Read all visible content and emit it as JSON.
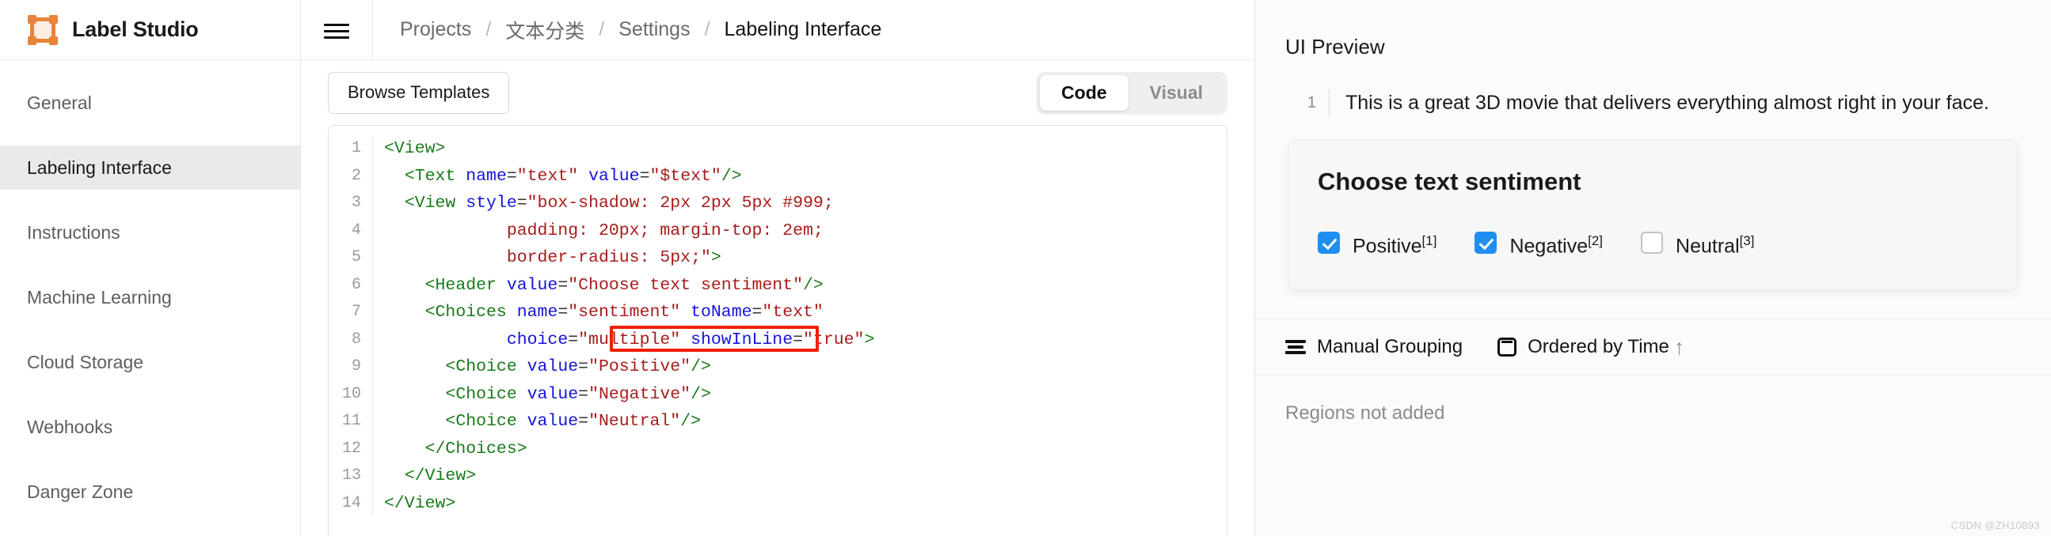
{
  "brand": {
    "title": "Label Studio",
    "logo_icon": "label-studio-logo-icon",
    "accent": "#e8833a"
  },
  "sidebar": {
    "items": [
      {
        "label": "General",
        "active": false
      },
      {
        "label": "Labeling Interface",
        "active": true
      },
      {
        "label": "Instructions",
        "active": false
      },
      {
        "label": "Machine Learning",
        "active": false
      },
      {
        "label": "Cloud Storage",
        "active": false
      },
      {
        "label": "Webhooks",
        "active": false
      },
      {
        "label": "Danger Zone",
        "active": false
      }
    ]
  },
  "topbar": {
    "menu_icon": "hamburger-menu-icon",
    "breadcrumb": [
      {
        "label": "Projects",
        "current": false
      },
      {
        "label": "文本分类",
        "current": false
      },
      {
        "label": "Settings",
        "current": false
      },
      {
        "label": "Labeling Interface",
        "current": true
      }
    ],
    "separator": "/"
  },
  "editor": {
    "browse_templates_label": "Browse Templates",
    "view_toggle": {
      "options": [
        {
          "label": "Code",
          "selected": true
        },
        {
          "label": "Visual",
          "selected": false
        }
      ]
    },
    "lines": [
      {
        "n": "1",
        "tokens": [
          {
            "t": "tg",
            "s": "<View>"
          }
        ]
      },
      {
        "n": "2",
        "tokens": [
          {
            "t": "pl",
            "s": "  "
          },
          {
            "t": "tg",
            "s": "<Text "
          },
          {
            "t": "at",
            "s": "name"
          },
          {
            "t": "pl",
            "s": "="
          },
          {
            "t": "vl",
            "s": "\"text\""
          },
          {
            "t": "pl",
            "s": " "
          },
          {
            "t": "at",
            "s": "value"
          },
          {
            "t": "pl",
            "s": "="
          },
          {
            "t": "vl",
            "s": "\"$text\""
          },
          {
            "t": "tg",
            "s": "/>"
          }
        ]
      },
      {
        "n": "3",
        "tokens": [
          {
            "t": "pl",
            "s": "  "
          },
          {
            "t": "tg",
            "s": "<View "
          },
          {
            "t": "at",
            "s": "style"
          },
          {
            "t": "pl",
            "s": "="
          },
          {
            "t": "vl",
            "s": "\"box-shadow: 2px 2px 5px #999;"
          }
        ]
      },
      {
        "n": "4",
        "tokens": [
          {
            "t": "pl",
            "s": "            "
          },
          {
            "t": "vl",
            "s": "padding: 20px; margin-top: 2em;"
          }
        ]
      },
      {
        "n": "5",
        "tokens": [
          {
            "t": "pl",
            "s": "            "
          },
          {
            "t": "vl",
            "s": "border-radius: 5px;\""
          },
          {
            "t": "tg",
            "s": ">"
          }
        ]
      },
      {
        "n": "6",
        "tokens": [
          {
            "t": "pl",
            "s": "    "
          },
          {
            "t": "tg",
            "s": "<Header "
          },
          {
            "t": "at",
            "s": "value"
          },
          {
            "t": "pl",
            "s": "="
          },
          {
            "t": "vl",
            "s": "\"Choose text sentiment\""
          },
          {
            "t": "tg",
            "s": "/>"
          }
        ]
      },
      {
        "n": "7",
        "tokens": [
          {
            "t": "pl",
            "s": "    "
          },
          {
            "t": "tg",
            "s": "<Choices "
          },
          {
            "t": "at",
            "s": "name"
          },
          {
            "t": "pl",
            "s": "="
          },
          {
            "t": "vl",
            "s": "\"sentiment\""
          },
          {
            "t": "pl",
            "s": " "
          },
          {
            "t": "at",
            "s": "toName"
          },
          {
            "t": "pl",
            "s": "="
          },
          {
            "t": "vl",
            "s": "\"text\""
          }
        ]
      },
      {
        "n": "8",
        "tokens": [
          {
            "t": "pl",
            "s": "            "
          },
          {
            "t": "at",
            "s": "choice"
          },
          {
            "t": "pl",
            "s": "="
          },
          {
            "t": "vl",
            "s": "\"multiple\""
          },
          {
            "t": "pl",
            "s": " "
          },
          {
            "t": "at",
            "s": "showInLine"
          },
          {
            "t": "pl",
            "s": "="
          },
          {
            "t": "vl",
            "s": "\"true\""
          },
          {
            "t": "tg",
            "s": ">"
          }
        ]
      },
      {
        "n": "9",
        "tokens": [
          {
            "t": "pl",
            "s": "      "
          },
          {
            "t": "tg",
            "s": "<Choice "
          },
          {
            "t": "at",
            "s": "value"
          },
          {
            "t": "pl",
            "s": "="
          },
          {
            "t": "vl",
            "s": "\"Positive\""
          },
          {
            "t": "tg",
            "s": "/>"
          }
        ]
      },
      {
        "n": "10",
        "tokens": [
          {
            "t": "pl",
            "s": "      "
          },
          {
            "t": "tg",
            "s": "<Choice "
          },
          {
            "t": "at",
            "s": "value"
          },
          {
            "t": "pl",
            "s": "="
          },
          {
            "t": "vl",
            "s": "\"Negative\""
          },
          {
            "t": "tg",
            "s": "/>"
          }
        ]
      },
      {
        "n": "11",
        "tokens": [
          {
            "t": "pl",
            "s": "      "
          },
          {
            "t": "tg",
            "s": "<Choice "
          },
          {
            "t": "at",
            "s": "value"
          },
          {
            "t": "pl",
            "s": "="
          },
          {
            "t": "vl",
            "s": "\"Neutral\""
          },
          {
            "t": "tg",
            "s": "/>"
          }
        ]
      },
      {
        "n": "12",
        "tokens": [
          {
            "t": "pl",
            "s": "    "
          },
          {
            "t": "tg",
            "s": "</Choices>"
          }
        ]
      },
      {
        "n": "13",
        "tokens": [
          {
            "t": "pl",
            "s": "  "
          },
          {
            "t": "tg",
            "s": "</View>"
          }
        ]
      },
      {
        "n": "14",
        "tokens": [
          {
            "t": "tg",
            "s": "</View>"
          }
        ]
      }
    ],
    "highlight": {
      "text": "choice=\"multiple\"",
      "color": "#f01f00",
      "line": "8"
    }
  },
  "preview": {
    "title": "UI Preview",
    "task": {
      "line_number": "1",
      "text": "This is a great 3D movie that delivers everything almost right in your face."
    },
    "choices_card": {
      "header": "Choose text sentiment",
      "options": [
        {
          "label": "Positive",
          "hotkey": "[1]",
          "checked": true
        },
        {
          "label": "Negative",
          "hotkey": "[2]",
          "checked": true
        },
        {
          "label": "Neutral",
          "hotkey": "[3]",
          "checked": false
        }
      ]
    },
    "regions_toolbar": {
      "grouping_label": "Manual Grouping",
      "grouping_icon": "grouping-lines-icon",
      "order_label": "Ordered by Time",
      "order_icon": "card-order-icon",
      "sort_direction_icon": "arrow-up-icon",
      "sort_direction_glyph": "↑"
    },
    "regions_empty_text": "Regions not added"
  },
  "watermark": "CSDN @ZH10893"
}
